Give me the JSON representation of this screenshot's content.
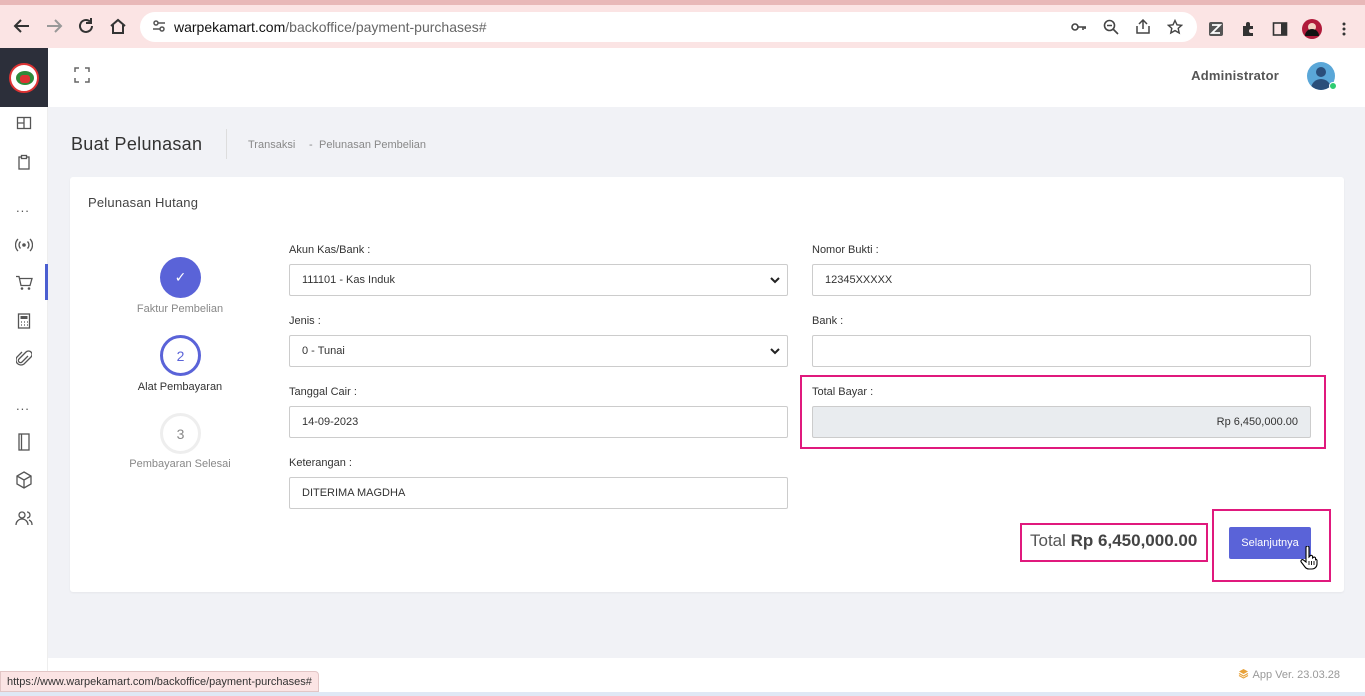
{
  "browser": {
    "url_host": "warpekamart.com",
    "url_path": "/backoffice/payment-purchases#",
    "status_url": "https://www.warpekamart.com/backoffice/payment-purchases#"
  },
  "sidebar": {
    "items": [
      "dashboard-icon",
      "clipboard-icon",
      "dots",
      "broadcast-icon",
      "cart-icon",
      "calculator-icon",
      "paperclip-icon",
      "dots",
      "book-icon",
      "box-icon",
      "users-icon"
    ],
    "active": "cart-icon"
  },
  "topbar": {
    "user_name": "Administrator"
  },
  "header": {
    "title": "Buat Pelunasan",
    "breadcrumb_1": "Transaksi",
    "breadcrumb_sep": "-",
    "breadcrumb_2": "Pelunasan Pembelian"
  },
  "card": {
    "title": "Pelunasan Hutang"
  },
  "stepper": {
    "steps": [
      {
        "marker": "✓",
        "label": "Faktur Pembelian",
        "state": "done"
      },
      {
        "marker": "2",
        "label": "Alat Pembayaran",
        "state": "active"
      },
      {
        "marker": "3",
        "label": "Pembayaran Selesai",
        "state": "pending"
      }
    ]
  },
  "form": {
    "akun_label": "Akun Kas/Bank :",
    "akun_value": "111101 - Kas Induk",
    "jenis_label": "Jenis :",
    "jenis_value": "0 - Tunai",
    "tanggal_label": "Tanggal Cair :",
    "tanggal_value": "14-09-2023",
    "keterangan_label": "Keterangan :",
    "keterangan_value": "DITERIMA MAGDHA",
    "nomor_label": "Nomor Bukti :",
    "nomor_value": "12345XXXXX",
    "bank_label": "Bank :",
    "bank_value": "",
    "total_bayar_label": "Total Bayar :",
    "total_bayar_value": "Rp 6,450,000.00"
  },
  "summary": {
    "total_label": "Total",
    "total_value": "Rp 6,450,000.00",
    "next_button": "Selanjutnya"
  },
  "footer": {
    "app_version": "App Ver. 23.03.28"
  },
  "colors": {
    "primary": "#5a63d8",
    "highlight": "#e0197d",
    "chrome": "#fbe4e4"
  }
}
